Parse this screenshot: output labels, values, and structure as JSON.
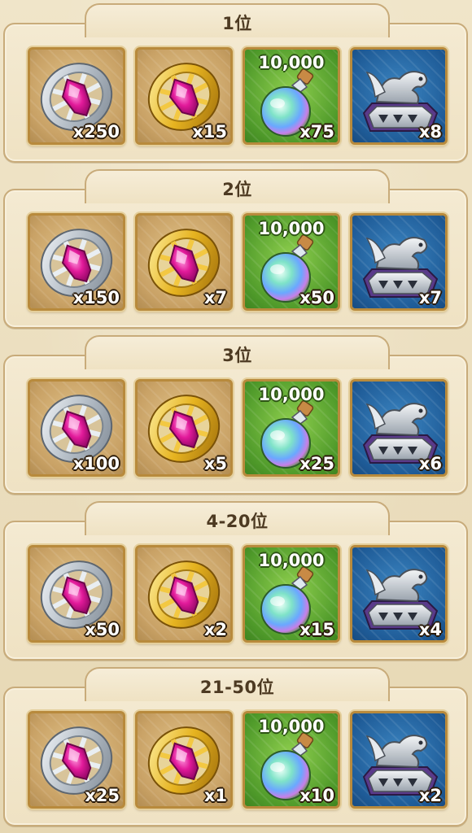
{
  "sections": [
    {
      "rank": "1位",
      "items": [
        {
          "icon": "silver-medal-icon",
          "qty": "x250"
        },
        {
          "icon": "gold-medal-icon",
          "qty": "x15"
        },
        {
          "icon": "potion-icon",
          "amount": "10,000",
          "qty": "x75"
        },
        {
          "icon": "dragon-chest-icon",
          "qty": "x8"
        }
      ]
    },
    {
      "rank": "2位",
      "items": [
        {
          "icon": "silver-medal-icon",
          "qty": "x150"
        },
        {
          "icon": "gold-medal-icon",
          "qty": "x7"
        },
        {
          "icon": "potion-icon",
          "amount": "10,000",
          "qty": "x50"
        },
        {
          "icon": "dragon-chest-icon",
          "qty": "x7"
        }
      ]
    },
    {
      "rank": "3位",
      "items": [
        {
          "icon": "silver-medal-icon",
          "qty": "x100"
        },
        {
          "icon": "gold-medal-icon",
          "qty": "x5"
        },
        {
          "icon": "potion-icon",
          "amount": "10,000",
          "qty": "x25"
        },
        {
          "icon": "dragon-chest-icon",
          "qty": "x6"
        }
      ]
    },
    {
      "rank": "4-20位",
      "items": [
        {
          "icon": "silver-medal-icon",
          "qty": "x50"
        },
        {
          "icon": "gold-medal-icon",
          "qty": "x2"
        },
        {
          "icon": "potion-icon",
          "amount": "10,000",
          "qty": "x15"
        },
        {
          "icon": "dragon-chest-icon",
          "qty": "x4"
        }
      ]
    },
    {
      "rank": "21-50位",
      "items": [
        {
          "icon": "silver-medal-icon",
          "qty": "x25"
        },
        {
          "icon": "gold-medal-icon",
          "qty": "x1"
        },
        {
          "icon": "potion-icon",
          "amount": "10,000",
          "qty": "x10"
        },
        {
          "icon": "dragon-chest-icon",
          "qty": "x2"
        }
      ]
    }
  ],
  "colors": {
    "background": "#e9dcbd",
    "panel_border": "#c8ab7a",
    "rank_text": "#4d3a22",
    "tile_gold": "#c9a266",
    "tile_green": "#4f9a2a",
    "tile_blue": "#1f5c98"
  }
}
